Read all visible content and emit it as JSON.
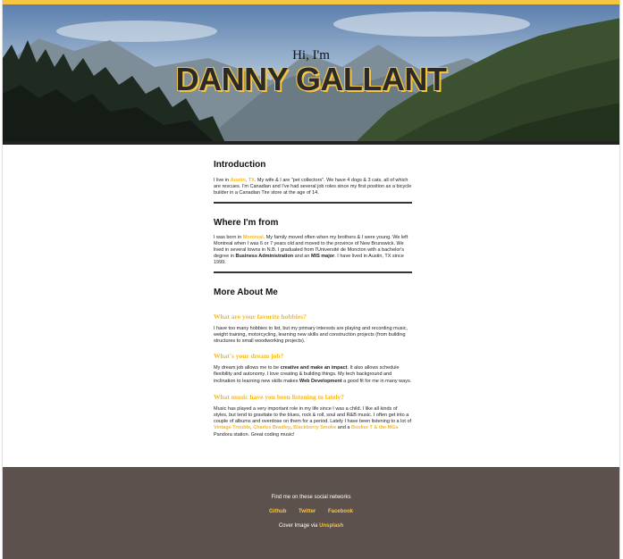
{
  "header": {
    "greeting": "Hi, I'm",
    "name": "DANNY GALLANT",
    "accent_color": "#f6c540"
  },
  "intro": {
    "title": "Introduction",
    "t1": "I live in ",
    "city": "Austin, TX",
    "t2": ". My wife & I are \"pet collectors\". We have 4 dogs & 3 cats, all of which are rescues. I'm Canadian and I've had several job roles since my first position as a bicycle builder in a Canadian Tire store at the age of 14."
  },
  "from": {
    "title": "Where I'm from",
    "t1": "I was born in ",
    "city": "Montreal",
    "t2": ". My family moved often when my brothers & I were young. We left Montreal when I was 6 or 7 years old and moved to the province of New Brunswick. We lived in several towns in N.B. I graduated from l'Université de Moncton with a bachelor's degree in ",
    "degree": "Business Administration",
    "t3": " and an ",
    "major": "MIS major",
    "t4": ". I have lived in Austin, TX since 1999."
  },
  "more": {
    "title": "More About Me",
    "q1": "What are your favorite hobbies?",
    "a1": "I have too many hobbies to list, but my primary interests are playing and recording music, weight training, motorcycling, learning new skills and construction projects (from building structures to small woodworking projects).",
    "q2": "What's your dream job?",
    "a2_1": "My dream job allows me to be ",
    "a2_b1": "creative and make an impact",
    "a2_2": ". It also allows schedule flexibility and autonomy. I love creating & building things. My tech background and inclination to learning new skills makes ",
    "a2_b2": "Web Development",
    "a2_3": " a good fit for me in many ways.",
    "q3": "What music have you been listening to lately?",
    "a3_1": "Music has played a very important role in my life since I was a child. I like all kinds of styles, but tend to gravitate to the blues, rock & roll, soul and R&B music. I often get into a couple of albums and overdose on them for a period. Lately I have been listening to a lot of ",
    "band1": "Vintage Trouble",
    "sep1": ", ",
    "band2": "Charles Bradley",
    "sep2": ", ",
    "band3": "Blackberry Smoke",
    "a3_2": " and a ",
    "band4": "Booker T & the MGs",
    "a3_3": " Pandora station. Great coding music!"
  },
  "footer": {
    "social_title": "Find me on these social networks",
    "links": [
      "Github",
      "Twitter",
      "Facebook"
    ],
    "credit": "Cover Image via ",
    "credit_link": "Unsplash",
    "bg_color": "#5c514c"
  }
}
